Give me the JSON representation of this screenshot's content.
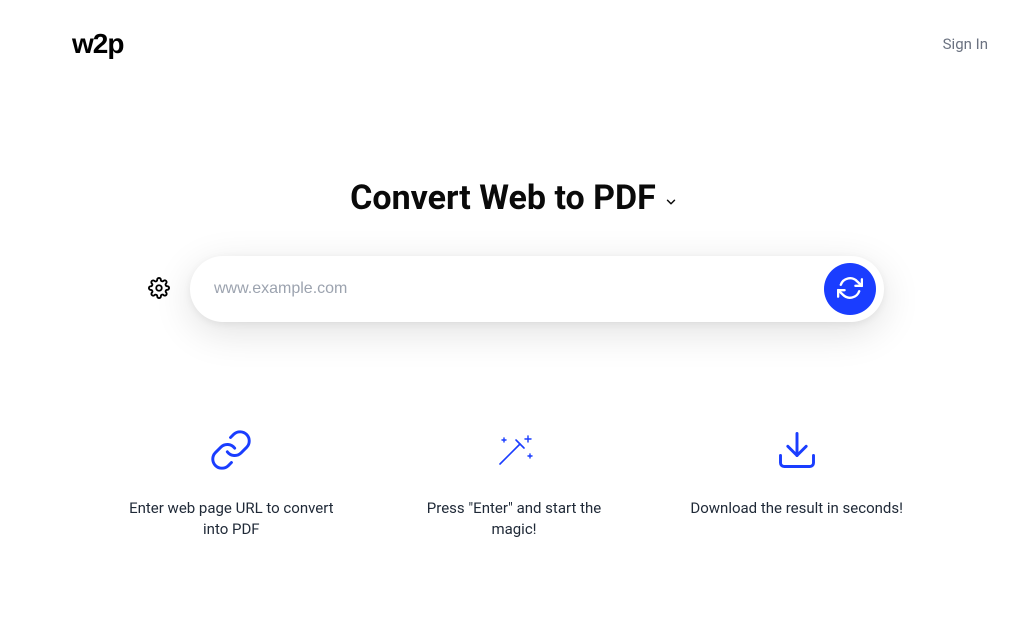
{
  "header": {
    "logo": "w2p",
    "sign_in": "Sign In"
  },
  "title": "Convert Web to PDF",
  "input": {
    "placeholder": "www.example.com",
    "value": ""
  },
  "features": [
    {
      "text": "Enter web page URL to convert into PDF"
    },
    {
      "text": "Press \"Enter\" and start the magic!"
    },
    {
      "text": "Download the result in seconds!"
    }
  ],
  "colors": {
    "accent": "#1a3dff"
  }
}
